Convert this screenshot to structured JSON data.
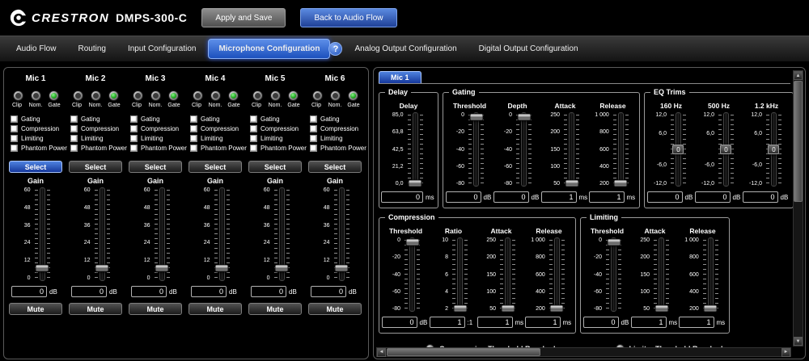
{
  "colors": {
    "background": "#000000",
    "accent_blue": "#2f6bd8",
    "led_green": "#1fa51f",
    "panel_border": "#5a5a5a",
    "threshold_marker_red": "#cf2222"
  },
  "icons": {
    "logo": "crestron-swirl",
    "help": "?",
    "scroll_up": "▲",
    "scroll_down": "▼",
    "scroll_left": "◄",
    "scroll_right": "►"
  },
  "header": {
    "brand": "CRESTRON",
    "model": "DMPS-300-C",
    "apply_label": "Apply and Save",
    "back_label": "Back to Audio Flow"
  },
  "tabs": [
    {
      "label": "Audio Flow",
      "active": false
    },
    {
      "label": "Routing",
      "active": false
    },
    {
      "label": "Input Configuration",
      "active": false
    },
    {
      "label": "Microphone Configuration",
      "active": true
    },
    {
      "label": "Analog Output Configuration",
      "active": false
    },
    {
      "label": "Digital Output Configuration",
      "active": false
    }
  ],
  "mic_panel": {
    "led_labels": [
      "Clip",
      "Nom.",
      "Gate"
    ],
    "checkbox_labels": [
      "Gating",
      "Compression",
      "Limiting",
      "Phantom Power"
    ],
    "checkbox_state": "unchecked",
    "select_label": "Select",
    "gain_label": "Gain",
    "mute_label": "Mute",
    "gain_scale": [
      "60",
      "48",
      "36",
      "24",
      "12",
      "0"
    ],
    "channels": [
      {
        "name": "Mic 1",
        "selected": true,
        "leds": {
          "clip": "off",
          "nom": "off",
          "gate": "on"
        },
        "value": "0",
        "unit": "dB",
        "handle_pct": 86
      },
      {
        "name": "Mic 2",
        "selected": false,
        "leds": {
          "clip": "off",
          "nom": "off",
          "gate": "on"
        },
        "value": "0",
        "unit": "dB",
        "handle_pct": 86
      },
      {
        "name": "Mic 3",
        "selected": false,
        "leds": {
          "clip": "off",
          "nom": "off",
          "gate": "on"
        },
        "value": "0",
        "unit": "dB",
        "handle_pct": 86
      },
      {
        "name": "Mic 4",
        "selected": false,
        "leds": {
          "clip": "off",
          "nom": "off",
          "gate": "on"
        },
        "value": "0",
        "unit": "dB",
        "handle_pct": 86
      },
      {
        "name": "Mic 5",
        "selected": false,
        "leds": {
          "clip": "off",
          "nom": "off",
          "gate": "on"
        },
        "value": "0",
        "unit": "dB",
        "handle_pct": 86
      },
      {
        "name": "Mic 6",
        "selected": false,
        "leds": {
          "clip": "off",
          "nom": "off",
          "gate": "on"
        },
        "value": "0",
        "unit": "dB",
        "handle_pct": 86
      }
    ]
  },
  "detail": {
    "tab": "Mic 1",
    "groups_top": [
      {
        "title": "Delay",
        "params": [
          {
            "label": "Delay",
            "scale": [
              "85,0",
              "63,8",
              "42,5",
              "21,2",
              "0,0"
            ],
            "value": "0",
            "unit": "ms",
            "handle_pct": 96,
            "wide": true
          }
        ]
      },
      {
        "title": "Gating",
        "params": [
          {
            "label": "Threshold",
            "scale": [
              "0",
              "-20",
              "-40",
              "-60",
              "-80"
            ],
            "value": "0",
            "unit": "dB",
            "handle_pct": 7,
            "red": true
          },
          {
            "label": "Depth",
            "scale": [
              "0",
              "-20",
              "-40",
              "-60",
              "-80"
            ],
            "value": "0",
            "unit": "dB",
            "handle_pct": 7
          },
          {
            "label": "Attack",
            "scale": [
              "250",
              "200",
              "150",
              "100",
              "50"
            ],
            "value": "1",
            "unit": "ms",
            "handle_pct": 96
          },
          {
            "label": "Release",
            "scale": [
              "1 000",
              "800",
              "600",
              "400",
              "200"
            ],
            "value": "1",
            "unit": "ms",
            "handle_pct": 96
          }
        ]
      },
      {
        "title": "EQ Trims",
        "params": [
          {
            "label": "160 Hz",
            "scale": [
              "12,0",
              "6,0",
              "",
              "-6,0",
              "-12,0"
            ],
            "value": "0",
            "unit": "dB",
            "handle_pct": 50,
            "handle_label": "0"
          },
          {
            "label": "500 Hz",
            "scale": [
              "12,0",
              "6,0",
              "",
              "-6,0",
              "-12,0"
            ],
            "value": "0",
            "unit": "dB",
            "handle_pct": 50,
            "handle_label": "0"
          },
          {
            "label": "1.2 kHz",
            "scale": [
              "12,0",
              "6,0",
              "",
              "-6,0",
              "-12,0"
            ],
            "value": "0",
            "unit": "dB",
            "handle_pct": 50,
            "handle_label": "0"
          }
        ]
      }
    ],
    "groups_bottom": [
      {
        "title": "Compression",
        "params": [
          {
            "label": "Threshold",
            "scale": [
              "0",
              "-20",
              "-40",
              "-60",
              "-80"
            ],
            "value": "0",
            "unit": "dB",
            "handle_pct": 7,
            "red": true
          },
          {
            "label": "Ratio",
            "scale": [
              "10",
              "8",
              "6",
              "4",
              "2"
            ],
            "value": "1",
            "unit": ":1",
            "handle_pct": 96
          },
          {
            "label": "Attack",
            "scale": [
              "250",
              "200",
              "150",
              "100",
              "50"
            ],
            "value": "1",
            "unit": "ms",
            "handle_pct": 96
          },
          {
            "label": "Release",
            "scale": [
              "1 000",
              "800",
              "600",
              "400",
              "200"
            ],
            "value": "1",
            "unit": "ms",
            "handle_pct": 96
          }
        ]
      },
      {
        "title": "Limiting",
        "params": [
          {
            "label": "Threshold",
            "scale": [
              "0",
              "-20",
              "-40",
              "-60",
              "-80"
            ],
            "value": "0",
            "unit": "dB",
            "handle_pct": 7,
            "red": true
          },
          {
            "label": "Attack",
            "scale": [
              "250",
              "200",
              "150",
              "100",
              "50"
            ],
            "value": "1",
            "unit": "ms",
            "handle_pct": 96
          },
          {
            "label": "Release",
            "scale": [
              "1 000",
              "800",
              "600",
              "400",
              "200"
            ],
            "value": "1",
            "unit": "ms",
            "handle_pct": 96
          }
        ]
      }
    ],
    "indicators": [
      {
        "label": "Compression Threshold Reached",
        "state": "off"
      },
      {
        "label": "Limiter Threshold Reached",
        "state": "off"
      }
    ]
  }
}
